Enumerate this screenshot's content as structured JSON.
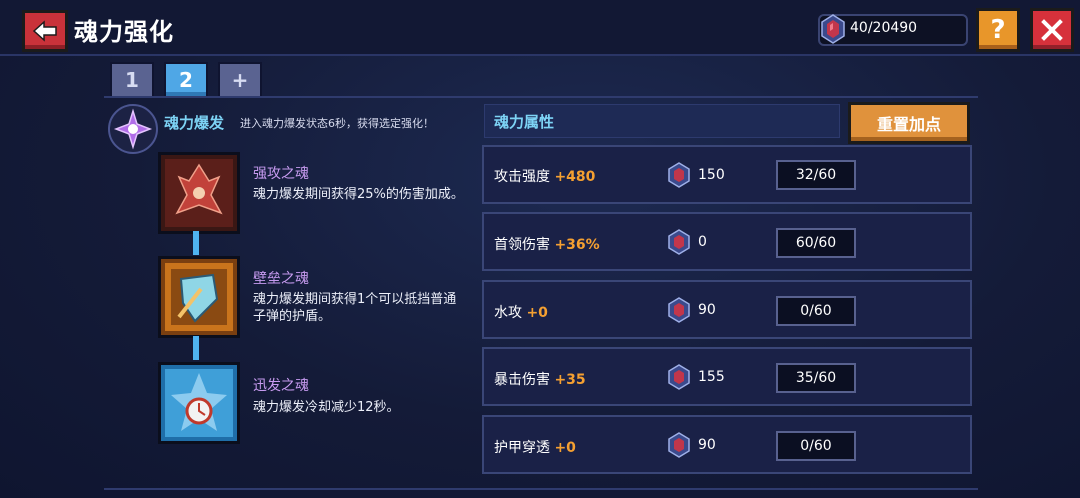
{
  "header": {
    "title": "魂力强化",
    "currency": "40/20490"
  },
  "tabs": [
    {
      "label": "1"
    },
    {
      "label": "2"
    },
    {
      "label": "+"
    }
  ],
  "burst": {
    "title": "魂力爆发",
    "description": "进入魂力爆发状态6秒，获得选定强化！"
  },
  "skills": [
    {
      "name": "强攻之魂",
      "description": "魂力爆发期间获得25%的伤害加成。"
    },
    {
      "name": "壁垒之魂",
      "description": "魂力爆发期间获得1个可以抵挡普通子弹的护盾。"
    },
    {
      "name": "迅发之魂",
      "description": "魂力爆发冷却减少12秒。"
    }
  ],
  "attributes_header": "魂力属性",
  "reset_label": "重置加点",
  "attributes": [
    {
      "name": "攻击强度",
      "bonus": "+480",
      "cost": "150",
      "level": "32/60"
    },
    {
      "name": "首领伤害",
      "bonus": "+36%",
      "cost": "0",
      "level": "60/60"
    },
    {
      "name": "水攻",
      "bonus": "+0",
      "cost": "90",
      "level": "0/60"
    },
    {
      "name": "暴击伤害",
      "bonus": "+35",
      "cost": "155",
      "level": "35/60"
    },
    {
      "name": "护甲穿透",
      "bonus": "+0",
      "cost": "90",
      "level": "0/60"
    }
  ],
  "icons": {
    "back": "back-arrow-icon",
    "help": "help-icon",
    "close": "close-icon",
    "currency": "soul-gem-icon",
    "burst": "soul-burst-icon"
  },
  "colors": {
    "accent_blue": "#7dd3f5",
    "bonus_orange": "#f5a031",
    "skill_purple": "#c79bf0",
    "button_orange": "#e0923c",
    "close_red": "#d6313b"
  }
}
